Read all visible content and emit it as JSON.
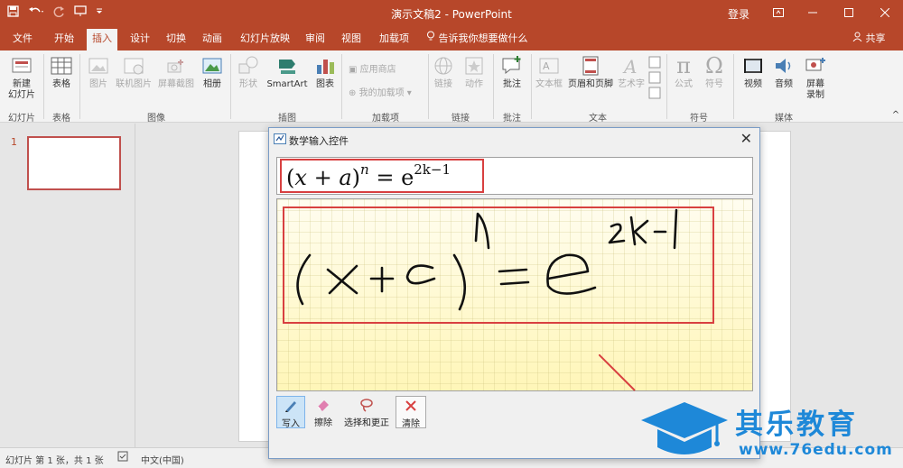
{
  "window": {
    "title": "演示文稿2 - PowerPoint",
    "login": "登录",
    "qat_icons": [
      "save-icon",
      "undo-icon",
      "redo-icon",
      "present-icon",
      "customize-icon"
    ]
  },
  "tabs": [
    {
      "label": "文件"
    },
    {
      "label": "开始"
    },
    {
      "label": "插入"
    },
    {
      "label": "设计"
    },
    {
      "label": "切换"
    },
    {
      "label": "动画"
    },
    {
      "label": "幻灯片放映"
    },
    {
      "label": "审阅"
    },
    {
      "label": "视图"
    },
    {
      "label": "加载项"
    }
  ],
  "active_tab": "插入",
  "tellme": "告诉我你想要做什么",
  "share": "共享",
  "ribbon": {
    "new_slide": "新建\n幻灯片",
    "table": "表格",
    "picture": "图片",
    "online_picture": "联机图片",
    "screenshot": "屏幕截图",
    "album": "相册",
    "shapes": "形状",
    "smartart": "SmartArt",
    "chart": "图表",
    "store": "应用商店",
    "my_addins": "我的加载项",
    "link": "链接",
    "action": "动作",
    "comment": "批注",
    "textbox": "文本框",
    "header_footer": "页眉和页脚",
    "wordart": "艺术字",
    "equation": "公式",
    "symbol": "符号",
    "video": "视频",
    "audio": "音频",
    "screen_record": "屏幕\n录制",
    "groups": {
      "slides": "幻灯片",
      "tables": "表格",
      "images": "图像",
      "illustrations": "插图",
      "addins": "加载项",
      "links": "链接",
      "comments": "批注",
      "text": "文本",
      "symbols": "符号",
      "media": "媒体"
    }
  },
  "thumbnails": [
    {
      "number": "1"
    }
  ],
  "dialog": {
    "title": "数学输入控件",
    "formula_parts": {
      "x": "x",
      "plus": "+",
      "a": "a",
      "n": "n",
      "equals": "=",
      "e": "e",
      "exp": "2k−1"
    },
    "tools": [
      {
        "label": "写入",
        "icon": "pen-icon",
        "active": true
      },
      {
        "label": "擦除",
        "icon": "eraser-icon",
        "active": false
      },
      {
        "label": "选择和更正",
        "icon": "lasso-icon",
        "active": false
      },
      {
        "label": "清除",
        "icon": "clear-icon",
        "active": false
      }
    ]
  },
  "status": {
    "slide_info": "幻灯片 第 1 张，共 1 张",
    "language": "中文(中国)"
  },
  "watermark": {
    "brand": "其乐教育",
    "url": "www.76edu.com"
  },
  "colors": {
    "accent": "#b7472a",
    "highlight_red": "#d84040",
    "watermark_blue": "#1e88d8",
    "pad_yellow": "#fff9cc"
  }
}
